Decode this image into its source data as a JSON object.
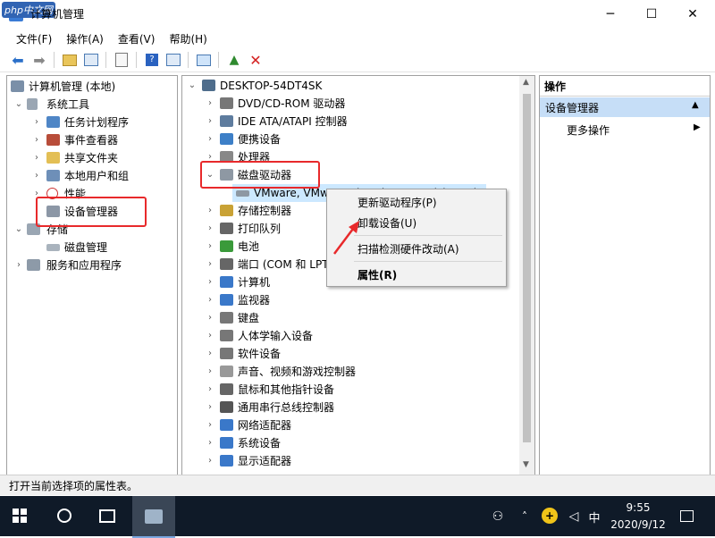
{
  "window": {
    "watermark": "php中文网",
    "title": "计算机管理"
  },
  "menubar": {
    "items": [
      "文件(F)",
      "操作(A)",
      "查看(V)",
      "帮助(H)"
    ]
  },
  "left_tree": {
    "root": "计算机管理 (本地)",
    "system_tools": "系统工具",
    "task_scheduler": "任务计划程序",
    "event_viewer": "事件查看器",
    "shared_folders": "共享文件夹",
    "local_users": "本地用户和组",
    "performance": "性能",
    "device_manager": "设备管理器",
    "storage": "存储",
    "disk_management": "磁盘管理",
    "services_apps": "服务和应用程序"
  },
  "device_tree": {
    "computer": "DESKTOP-54DT4SK",
    "categories": [
      "DVD/CD-ROM 驱动器",
      "IDE ATA/ATAPI 控制器",
      "便携设备",
      "处理器",
      "磁盘驱动器",
      "存储控制器",
      "打印队列",
      "电池",
      "端口 (COM 和 LPT)",
      "计算机",
      "监视器",
      "键盘",
      "人体学输入设备",
      "软件设备",
      "声音、视频和游戏控制器",
      "鼠标和其他指针设备",
      "通用串行总线控制器",
      "网络适配器",
      "系统设备",
      "显示适配器"
    ],
    "disk_child": "VMware, VMware Virtual S SCSI Disk Device"
  },
  "context_menu": {
    "items": [
      "更新驱动程序(P)",
      "卸载设备(U)",
      "扫描检测硬件改动(A)",
      "属性(R)"
    ]
  },
  "actions_pane": {
    "title": "操作",
    "section": "设备管理器",
    "more": "更多操作"
  },
  "statusbar": {
    "text": "打开当前选择项的属性表。"
  },
  "taskbar": {
    "ime": "中",
    "time": "9:55",
    "date": "2020/9/12"
  },
  "colors": {
    "accent": "#e8292b",
    "selection": "#cce8ff",
    "actions_header": "#c6def7",
    "taskbar": "#0f1a28"
  }
}
